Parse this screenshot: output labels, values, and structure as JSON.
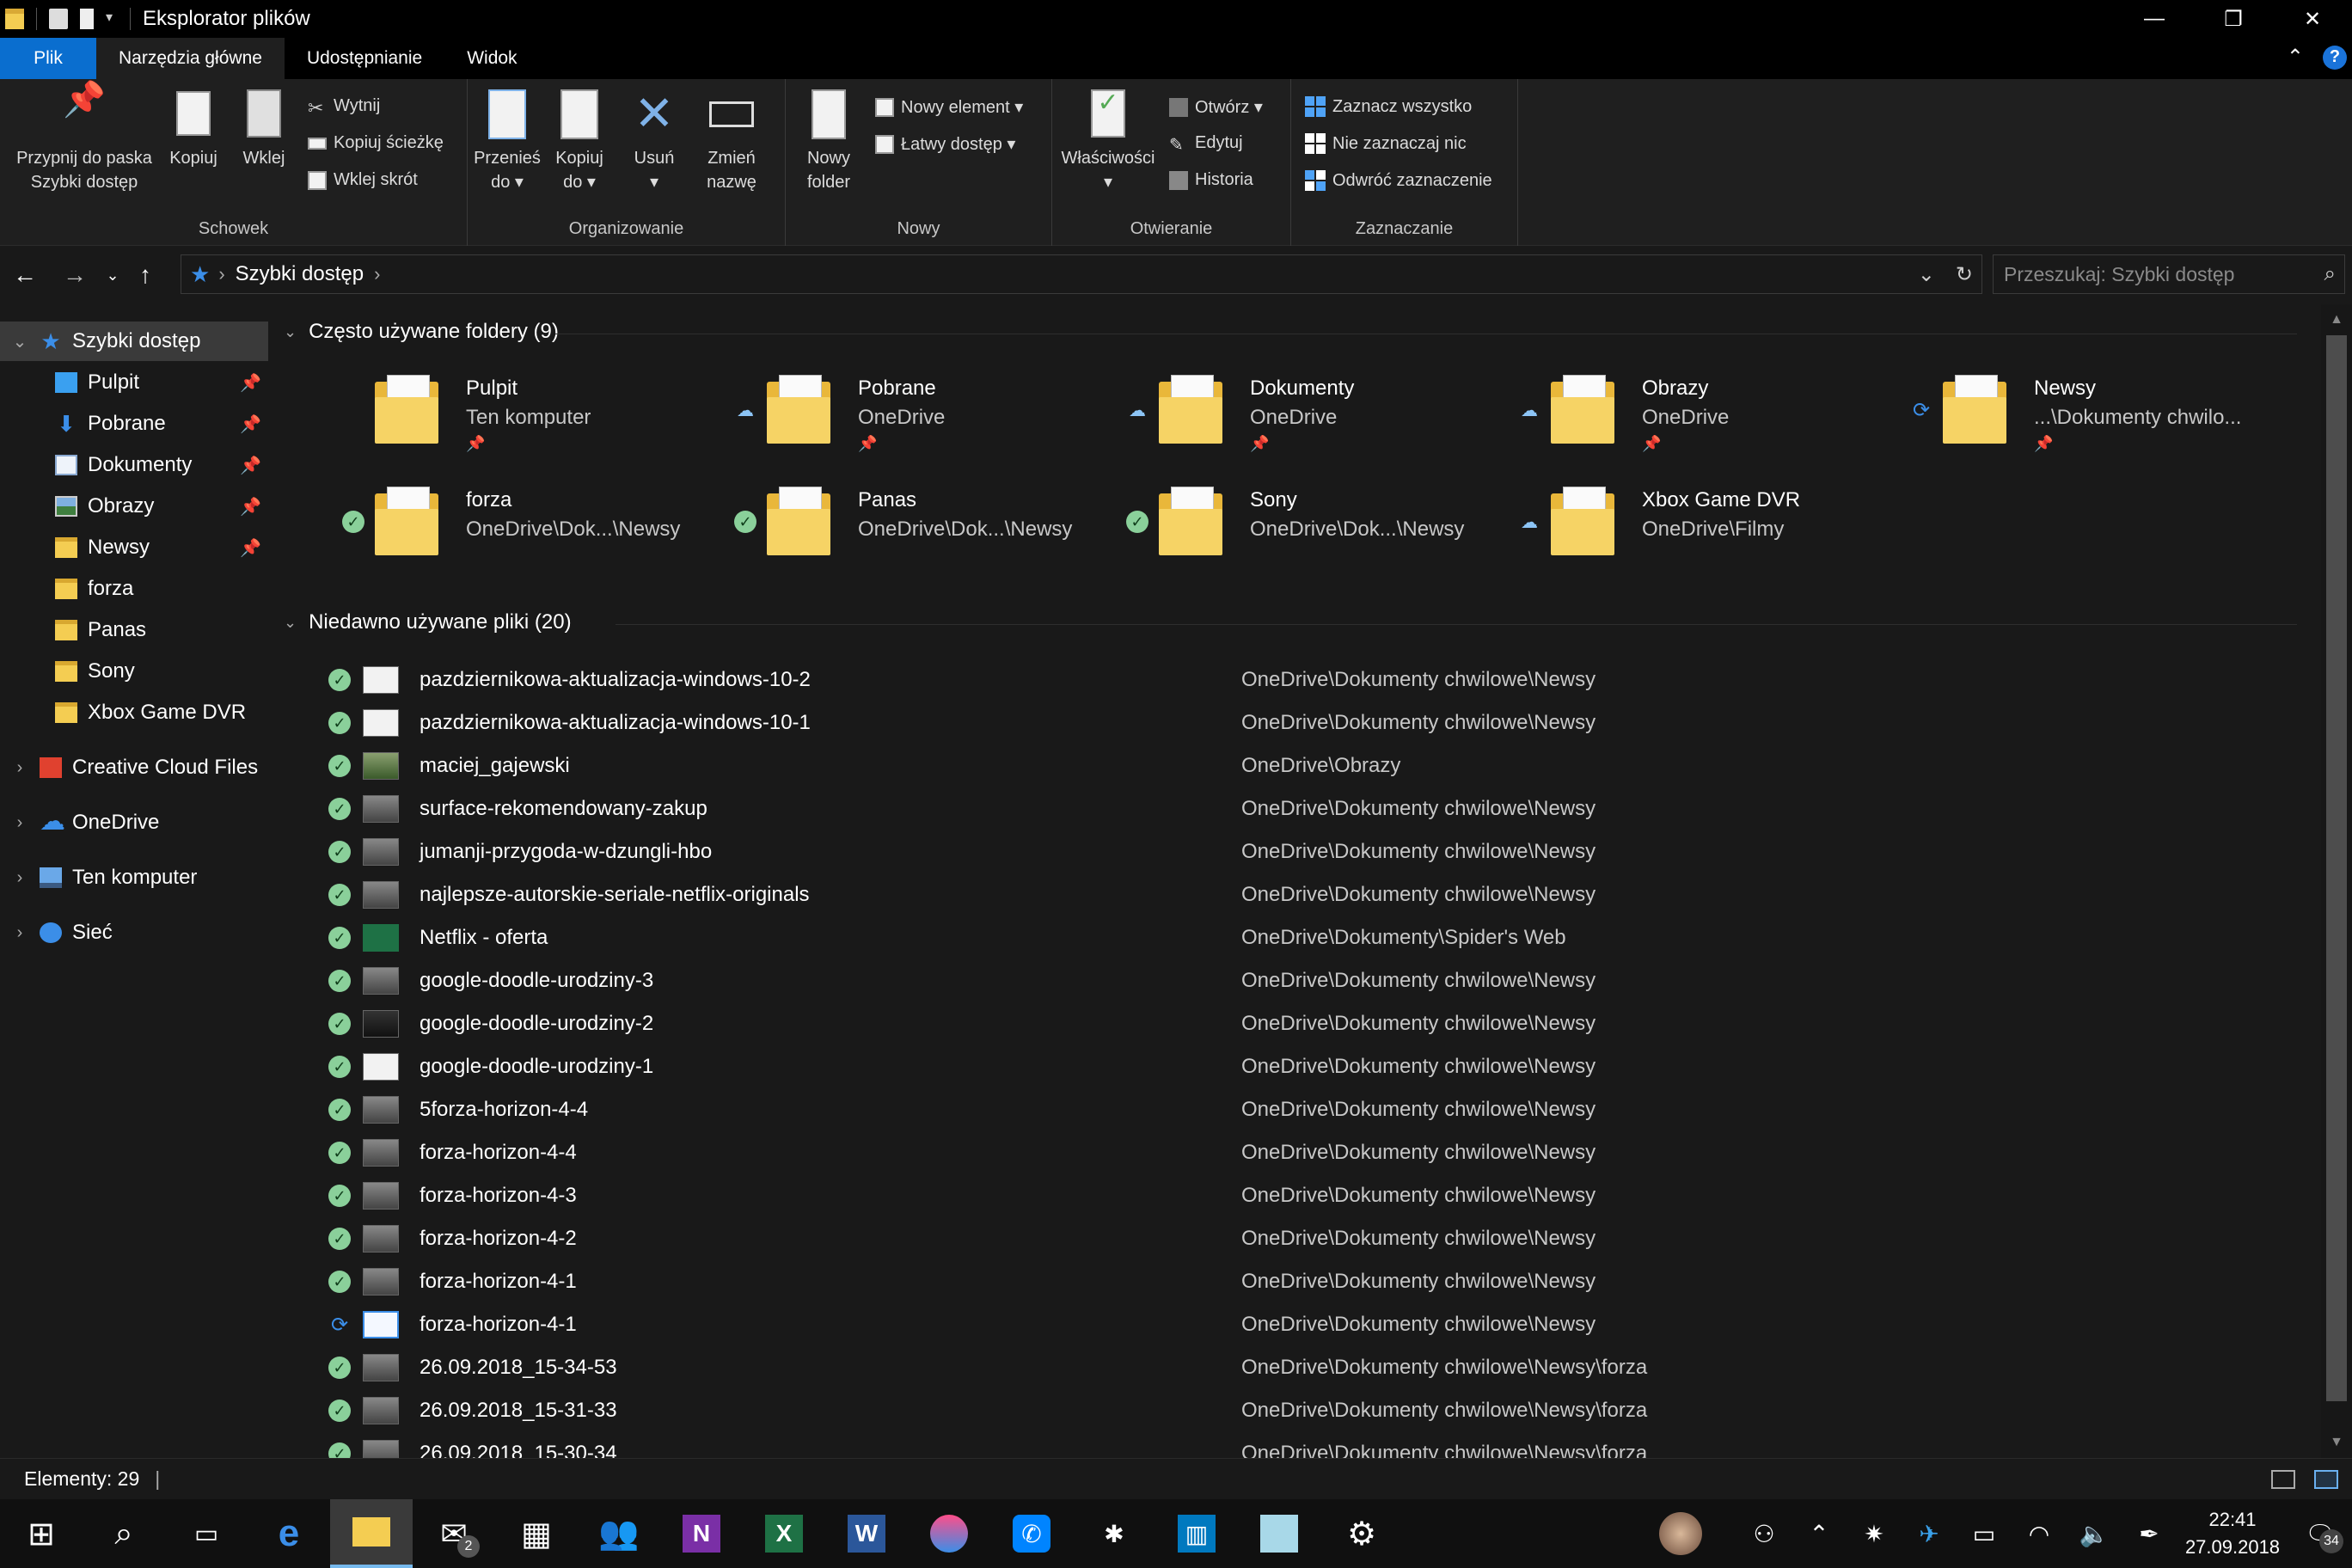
{
  "window": {
    "title": "Eksplorator plików",
    "controls": [
      "—",
      "❐",
      "✕"
    ]
  },
  "ribbon_tabs": [
    "Plik",
    "Narzędzia główne",
    "Udostępnianie",
    "Widok"
  ],
  "ribbon": {
    "schowek": {
      "label": "Schowek",
      "pin": "Przypnij do paska Szybki dostęp",
      "pin_l1": "Przypnij do paska",
      "pin_l2": "Szybki dostęp",
      "copy": "Kopiuj",
      "paste": "Wklej",
      "cut": "Wytnij",
      "copy_path": "Kopiuj ścieżkę",
      "paste_shortcut": "Wklej skrót"
    },
    "organizowanie": {
      "label": "Organizowanie",
      "move_l1": "Przenieś",
      "move_l2": "do ▾",
      "copyto_l1": "Kopiuj",
      "copyto_l2": "do ▾",
      "delete_l1": "Usuń",
      "delete_l2": "▾",
      "rename_l1": "Zmień",
      "rename_l2": "nazwę"
    },
    "nowy": {
      "label": "Nowy",
      "new_folder_l1": "Nowy",
      "new_folder_l2": "folder",
      "new_item": "Nowy element ▾",
      "easy_access": "Łatwy dostęp ▾"
    },
    "otwieranie": {
      "label": "Otwieranie",
      "properties": "Właściwości",
      "properties_arrow": "▾",
      "open": "Otwórz ▾",
      "edit": "Edytuj",
      "history": "Historia"
    },
    "zaznaczanie": {
      "label": "Zaznaczanie",
      "select_all": "Zaznacz wszystko",
      "select_none": "Nie zaznaczaj nic",
      "invert": "Odwróć zaznaczenie"
    }
  },
  "address": {
    "crumb": "Szybki dostęp",
    "search_placeholder": "Przeszukaj: Szybki dostęp"
  },
  "sidebar": {
    "quick_access": "Szybki dostęp",
    "items": [
      {
        "label": "Pulpit",
        "pinned": true
      },
      {
        "label": "Pobrane",
        "pinned": true
      },
      {
        "label": "Dokumenty",
        "pinned": true
      },
      {
        "label": "Obrazy",
        "pinned": true
      },
      {
        "label": "Newsy",
        "pinned": true
      },
      {
        "label": "forza",
        "pinned": false
      },
      {
        "label": "Panas",
        "pinned": false
      },
      {
        "label": "Sony",
        "pinned": false
      },
      {
        "label": "Xbox Game DVR",
        "pinned": false
      }
    ],
    "roots": [
      "Creative Cloud Files",
      "OneDrive",
      "Ten komputer",
      "Sieć"
    ]
  },
  "frequent": {
    "header": "Często używane foldery (9)",
    "folders": [
      {
        "name": "Pulpit",
        "loc": "Ten komputer",
        "status": "",
        "pin": true
      },
      {
        "name": "Pobrane",
        "loc": "OneDrive",
        "status": "cloud",
        "pin": true
      },
      {
        "name": "Dokumenty",
        "loc": "OneDrive",
        "status": "cloud",
        "pin": true
      },
      {
        "name": "Obrazy",
        "loc": "OneDrive",
        "status": "cloud",
        "pin": true
      },
      {
        "name": "Newsy",
        "loc": "...\\Dokumenty chwilo...",
        "status": "sync",
        "pin": true
      },
      {
        "name": "forza",
        "loc": "OneDrive\\Dok...\\Newsy",
        "status": "ok",
        "pin": false
      },
      {
        "name": "Panas",
        "loc": "OneDrive\\Dok...\\Newsy",
        "status": "ok",
        "pin": false
      },
      {
        "name": "Sony",
        "loc": "OneDrive\\Dok...\\Newsy",
        "status": "ok",
        "pin": false
      },
      {
        "name": "Xbox Game DVR",
        "loc": "OneDrive\\Filmy",
        "status": "cloud",
        "pin": false
      }
    ]
  },
  "recent": {
    "header": "Niedawno używane pliki (20)",
    "files": [
      {
        "name": "pazdziernikowa-aktualizacja-windows-10-2",
        "path": "OneDrive\\Dokumenty chwilowe\\Newsy",
        "status": "ok",
        "thumb": "white"
      },
      {
        "name": "pazdziernikowa-aktualizacja-windows-10-1",
        "path": "OneDrive\\Dokumenty chwilowe\\Newsy",
        "status": "ok",
        "thumb": "white"
      },
      {
        "name": "maciej_gajewski",
        "path": "OneDrive\\Obrazy",
        "status": "ok",
        "thumb": "person"
      },
      {
        "name": "surface-rekomendowany-zakup",
        "path": "OneDrive\\Dokumenty chwilowe\\Newsy",
        "status": "ok",
        "thumb": "grey"
      },
      {
        "name": "jumanji-przygoda-w-dzungli-hbo",
        "path": "OneDrive\\Dokumenty chwilowe\\Newsy",
        "status": "ok",
        "thumb": "grey"
      },
      {
        "name": "najlepsze-autorskie-seriale-netflix-originals",
        "path": "OneDrive\\Dokumenty chwilowe\\Newsy",
        "status": "ok",
        "thumb": "grey"
      },
      {
        "name": "Netflix - oferta",
        "path": "OneDrive\\Dokumenty\\Spider's Web",
        "status": "ok",
        "thumb": "excel"
      },
      {
        "name": "google-doodle-urodziny-3",
        "path": "OneDrive\\Dokumenty chwilowe\\Newsy",
        "status": "ok",
        "thumb": "grey"
      },
      {
        "name": "google-doodle-urodziny-2",
        "path": "OneDrive\\Dokumenty chwilowe\\Newsy",
        "status": "ok",
        "thumb": "dark"
      },
      {
        "name": "google-doodle-urodziny-1",
        "path": "OneDrive\\Dokumenty chwilowe\\Newsy",
        "status": "ok",
        "thumb": "white"
      },
      {
        "name": "5forza-horizon-4-4",
        "path": "OneDrive\\Dokumenty chwilowe\\Newsy",
        "status": "ok",
        "thumb": "grey"
      },
      {
        "name": "forza-horizon-4-4",
        "path": "OneDrive\\Dokumenty chwilowe\\Newsy",
        "status": "ok",
        "thumb": "grey"
      },
      {
        "name": "forza-horizon-4-3",
        "path": "OneDrive\\Dokumenty chwilowe\\Newsy",
        "status": "ok",
        "thumb": "grey"
      },
      {
        "name": "forza-horizon-4-2",
        "path": "OneDrive\\Dokumenty chwilowe\\Newsy",
        "status": "ok",
        "thumb": "grey"
      },
      {
        "name": "forza-horizon-4-1",
        "path": "OneDrive\\Dokumenty chwilowe\\Newsy",
        "status": "ok",
        "thumb": "grey"
      },
      {
        "name": "forza-horizon-4-1",
        "path": "OneDrive\\Dokumenty chwilowe\\Newsy",
        "status": "sync",
        "thumb": "img"
      },
      {
        "name": "26.09.2018_15-34-53",
        "path": "OneDrive\\Dokumenty chwilowe\\Newsy\\forza",
        "status": "ok",
        "thumb": "grey"
      },
      {
        "name": "26.09.2018_15-31-33",
        "path": "OneDrive\\Dokumenty chwilowe\\Newsy\\forza",
        "status": "ok",
        "thumb": "grey"
      },
      {
        "name": "26.09.2018_15-30-34",
        "path": "OneDrive\\Dokumenty chwilowe\\Newsy\\forza",
        "status": "ok",
        "thumb": "grey"
      }
    ]
  },
  "statusbar": {
    "text": "Elementy: 29"
  },
  "taskbar": {
    "mail_badge": "2",
    "clock_time": "22:41",
    "clock_date": "27.09.2018",
    "notifications": "34"
  },
  "colors": {
    "accent": "#0a6ecf",
    "ok_green": "#8ad09a",
    "folder_yellow": "#f4cd52"
  }
}
